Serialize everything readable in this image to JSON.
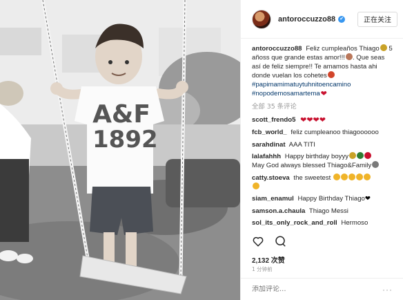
{
  "post": {
    "image_alt": "",
    "shirt_text_line1": "A&F",
    "shirt_text_line2": "1892"
  },
  "header": {
    "username": "antoroccuzzo88",
    "verified_mark": "✔",
    "follow_label": "正在关注"
  },
  "caption": {
    "username": "antoroccuzzo88",
    "text": "Feliz cumpleaños Thiago",
    "text2": "5 añoss que grande estas amor!!!",
    "text3": ". Que seas así de feliz siempre!! Te amamos hasta ahi donde vuelan los cohetes",
    "hashtag1": "#papimamimatuytuhnitoencamino",
    "hashtag2": "#nopodemosamartema"
  },
  "load_more": "全部 35 条评论",
  "comments": [
    {
      "user": "scott_frendo5",
      "text": "",
      "emoji": "❤❤❤❤"
    },
    {
      "user": "fcb_world_",
      "text": "feliz cumpleanoo thiagoooooo",
      "emoji": ""
    },
    {
      "user": "sarahdinat",
      "text": "AAA TITI",
      "emoji": ""
    },
    {
      "user": "lalafahhh",
      "text": "Happy birthday boyyy",
      "text2": "May God always blessed Thiago&Family",
      "emoji": ""
    },
    {
      "user": "catty.stoeva",
      "text": "the sweetest",
      "emoji": ""
    },
    {
      "user": "siam_enamul",
      "text": "Happy Birthday Thiago",
      "emoji": "❤"
    },
    {
      "user": "samson.a.chaula",
      "text": "Thiago Messi",
      "emoji": ""
    },
    {
      "user": "sol_its_only_rock_and_roll",
      "text": "Hermoso",
      "emoji": ""
    }
  ],
  "likes": "2,132 次赞",
  "time": "1 分钟前",
  "add_comment_placeholder": "添加评论...",
  "more_dots": "···",
  "colors": {
    "link": "#003569",
    "verified": "#3897f0",
    "heart": "#c8102e",
    "muted": "#999999"
  }
}
